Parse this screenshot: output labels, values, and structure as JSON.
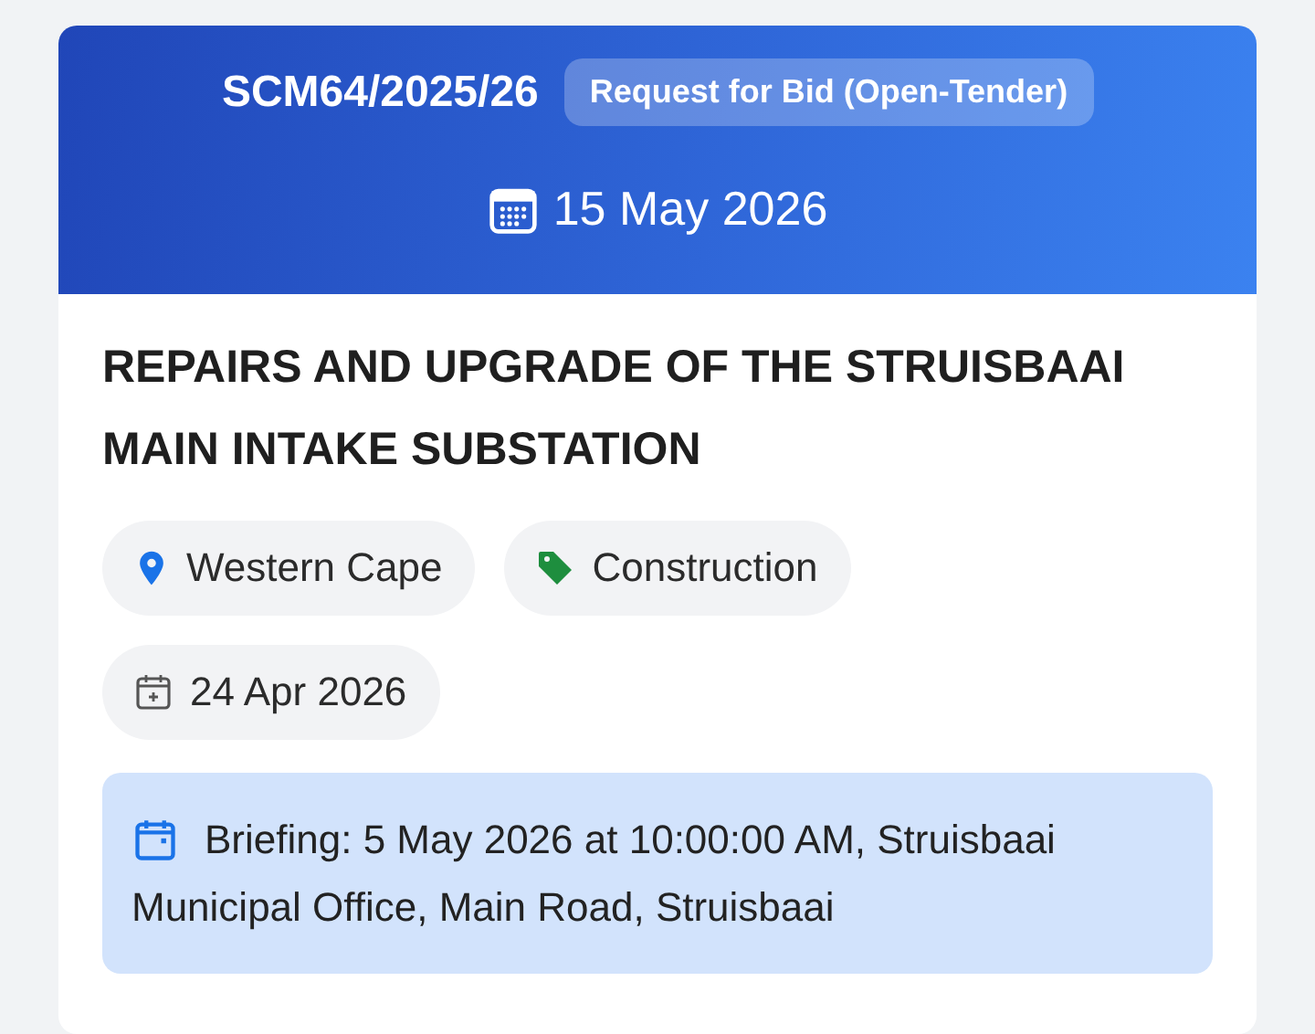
{
  "header": {
    "reference": "SCM64/2025/26",
    "type_badge": "Request for Bid (Open-Tender)",
    "closing_date": "15 May 2026"
  },
  "title": "REPAIRS AND UPGRADE OF THE STRUISBAAI MAIN INTAKE SUBSTATION",
  "chips": [
    {
      "kind": "location",
      "label": "Western Cape"
    },
    {
      "kind": "category",
      "label": "Construction"
    },
    {
      "kind": "date",
      "label": "24 Apr 2026"
    }
  ],
  "briefing": [
    "Briefing: 5 May 2026 at 10:00:00 AM, Struisbaai",
    "Municipal Office, Main Road, Struisbaai"
  ]
}
